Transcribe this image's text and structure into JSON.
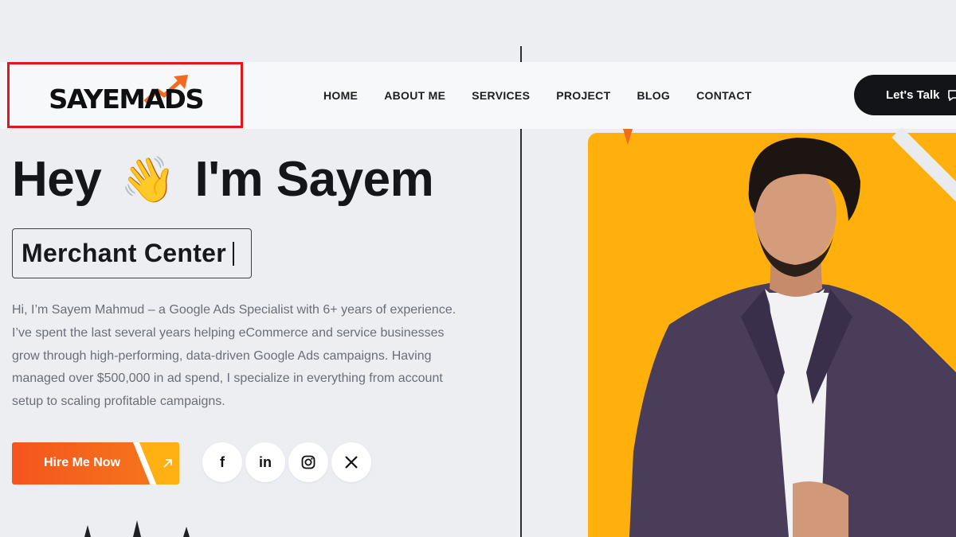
{
  "brand": {
    "logo_text": "SAYEMADS",
    "logo_alt": "SAYEM ADS"
  },
  "nav": {
    "items": [
      "HOME",
      "ABOUT ME",
      "SERVICES",
      "PROJECT",
      "BLOG",
      "CONTACT"
    ],
    "cta_label": "Let's Talk"
  },
  "hero": {
    "greeting_pre": "Hey",
    "greeting_emoji": "👋",
    "greeting_post": "I'm Sayem",
    "typed_text": "Merchant Center",
    "description": "Hi, I’m Sayem Mahmud – a Google Ads Specialist with 6+ years of experience. I’ve spent the last several years helping eCommerce and service businesses grow through high-performing, data-driven Google Ads campaigns. Having managed over $500,000 in ad spend, I specialize in everything from account setup to scaling profitable campaigns.",
    "hire_label": "Hire Me Now"
  },
  "socials": [
    {
      "name": "facebook-icon",
      "glyph": "f"
    },
    {
      "name": "linkedin-icon",
      "glyph": "in"
    },
    {
      "name": "instagram-icon",
      "glyph": ""
    },
    {
      "name": "x-icon",
      "glyph": ""
    }
  ],
  "colors": {
    "accent_orange": "#f4551d",
    "accent_yellow": "#ffb00d",
    "dark": "#131417",
    "highlight_border": "#e3151d"
  }
}
